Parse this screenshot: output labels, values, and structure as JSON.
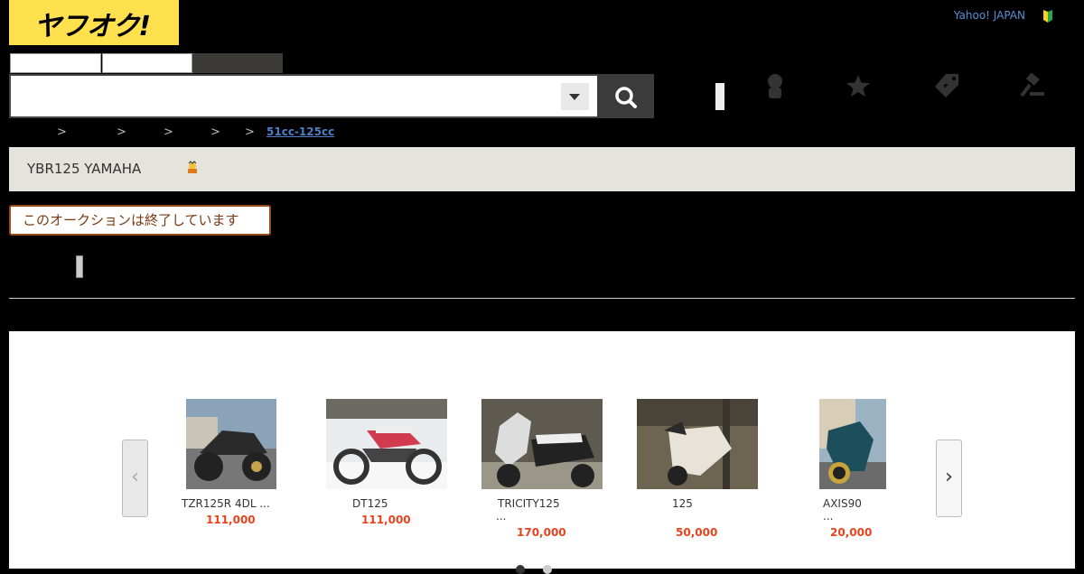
{
  "header": {
    "logo_text": "ヤフオク!",
    "yahoo_link": "Yahoo! JAPAN"
  },
  "breadcrumb": {
    "separators": [
      ">",
      ">",
      ">",
      ">",
      ">"
    ],
    "current": "51cc-125cc"
  },
  "item": {
    "title": "YBR125 YAMAHA",
    "status": "このオークションは終了しています"
  },
  "carousel": {
    "prev": "‹",
    "next": "›",
    "items": [
      {
        "name": "TZR125R 4DL ...",
        "name2": "",
        "price": "111,000"
      },
      {
        "name": "DT125",
        "name2": "",
        "price": "111,000"
      },
      {
        "name": "TRICITY125",
        "name2": "...",
        "price": "170,000"
      },
      {
        "name": "125",
        "name2": "",
        "price": "50,000"
      },
      {
        "name": "AXIS90",
        "name2": "...",
        "price": "20,000"
      }
    ]
  },
  "colors": {
    "logo_bg": "#ffe14e",
    "price": "#e8431c",
    "link": "#4d7fc8"
  }
}
